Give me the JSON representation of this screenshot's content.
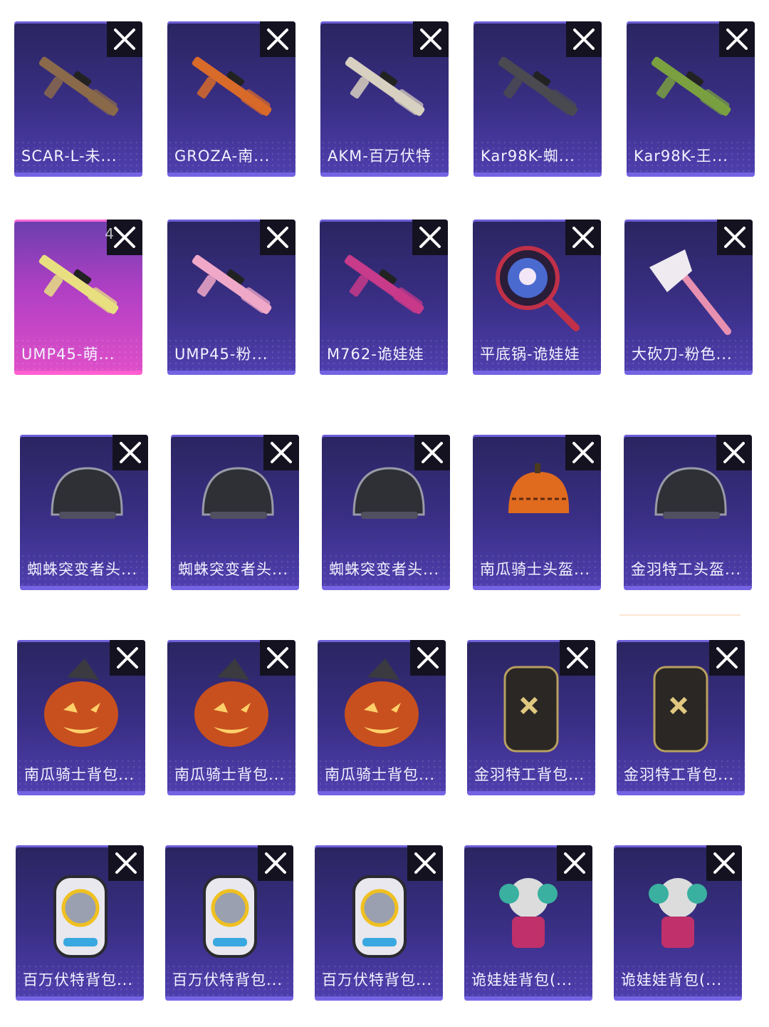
{
  "items": [
    {
      "label": "SCAR-L-未...",
      "icon": "rifle-icon",
      "rarity": "normal"
    },
    {
      "label": "GROZA-南...",
      "icon": "rifle-icon",
      "rarity": "normal"
    },
    {
      "label": "AKM-百万伏特",
      "icon": "rifle-icon",
      "rarity": "normal"
    },
    {
      "label": "Kar98K-蜘...",
      "icon": "sniper-icon",
      "rarity": "normal"
    },
    {
      "label": "Kar98K-王...",
      "icon": "sniper-icon",
      "rarity": "normal"
    },
    {
      "label": "UMP45-萌...",
      "icon": "smg-icon",
      "rarity": "pink",
      "badge": "4"
    },
    {
      "label": "UMP45-粉...",
      "icon": "smg-icon",
      "rarity": "normal"
    },
    {
      "label": "M762-诡娃娃",
      "icon": "rifle-icon",
      "rarity": "normal"
    },
    {
      "label": "平底锅-诡娃娃",
      "icon": "pan-icon",
      "rarity": "normal"
    },
    {
      "label": "大砍刀-粉色...",
      "icon": "axe-icon",
      "rarity": "normal"
    },
    {
      "label": "蜘蛛突变者头...",
      "icon": "helmet-icon",
      "rarity": "normal"
    },
    {
      "label": "蜘蛛突变者头...",
      "icon": "helmet-icon",
      "rarity": "normal"
    },
    {
      "label": "蜘蛛突变者头...",
      "icon": "helmet-icon",
      "rarity": "normal"
    },
    {
      "label": "南瓜骑士头盔...",
      "icon": "pumpkin-helmet-icon",
      "rarity": "normal"
    },
    {
      "label": "金羽特工头盔...",
      "icon": "helmet-icon",
      "rarity": "normal"
    },
    {
      "label": "南瓜骑士背包...",
      "icon": "pumpkin-backpack-icon",
      "rarity": "normal"
    },
    {
      "label": "南瓜骑士背包...",
      "icon": "pumpkin-backpack-icon",
      "rarity": "normal"
    },
    {
      "label": "南瓜骑士背包...",
      "icon": "pumpkin-backpack-icon",
      "rarity": "normal"
    },
    {
      "label": "金羽特工背包...",
      "icon": "backpack-icon",
      "rarity": "normal"
    },
    {
      "label": "金羽特工背包...",
      "icon": "backpack-icon",
      "rarity": "normal"
    },
    {
      "label": "百万伏特背包...",
      "icon": "robot-backpack-icon",
      "rarity": "normal"
    },
    {
      "label": "百万伏特背包...",
      "icon": "robot-backpack-icon",
      "rarity": "normal"
    },
    {
      "label": "百万伏特背包...",
      "icon": "robot-backpack-icon",
      "rarity": "normal"
    },
    {
      "label": "诡娃娃背包(...",
      "icon": "doll-backpack-icon",
      "rarity": "normal"
    },
    {
      "label": "诡娃娃背包(...",
      "icon": "doll-backpack-icon",
      "rarity": "normal"
    }
  ]
}
